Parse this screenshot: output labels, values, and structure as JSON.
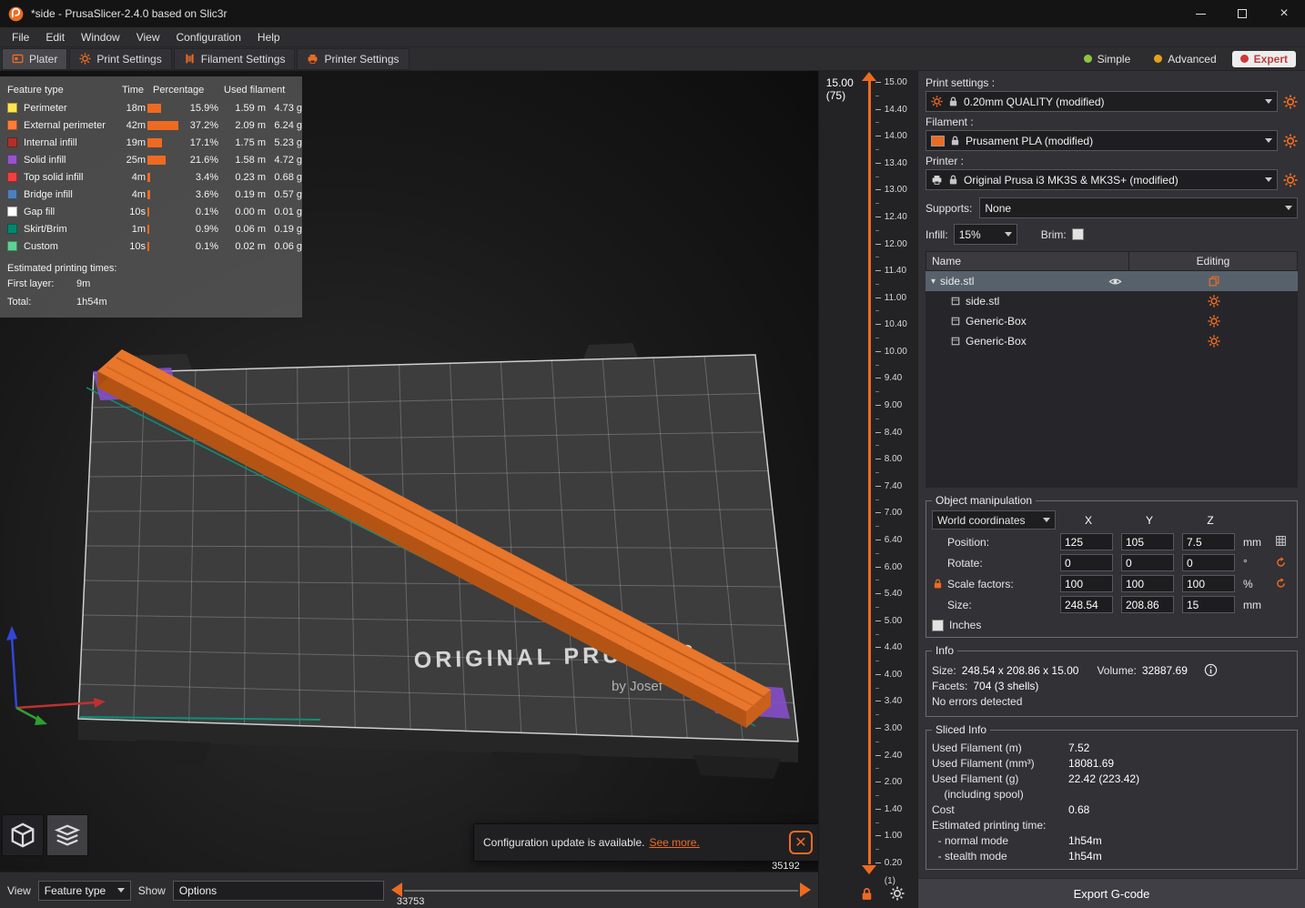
{
  "window": {
    "title": "*side - PrusaSlicer-2.4.0 based on Slic3r"
  },
  "menubar": [
    "File",
    "Edit",
    "Window",
    "View",
    "Configuration",
    "Help"
  ],
  "tabbar": {
    "tabs": [
      {
        "label": "Plater",
        "icon": "plater-icon",
        "active": true
      },
      {
        "label": "Print Settings",
        "icon": "gear-icon"
      },
      {
        "label": "Filament Settings",
        "icon": "filament-icon"
      },
      {
        "label": "Printer Settings",
        "icon": "printer-icon"
      }
    ],
    "modes": [
      {
        "label": "Simple",
        "dot": "#8cc63f"
      },
      {
        "label": "Advanced",
        "dot": "#e8a017"
      },
      {
        "label": "Expert",
        "dot": "#d03838",
        "active": true
      }
    ]
  },
  "legend": {
    "headers": {
      "feature": "Feature type",
      "time": "Time",
      "pct": "Percentage",
      "used": "Used filament"
    },
    "rows": [
      {
        "name": "Perimeter",
        "color": "#ffe64d",
        "time": "18m",
        "pct": "15.9%",
        "pct_val": 15.9,
        "len": "1.59 m",
        "wt": "4.73 g"
      },
      {
        "name": "External perimeter",
        "color": "#ff7d38",
        "time": "42m",
        "pct": "37.2%",
        "pct_val": 37.2,
        "len": "2.09 m",
        "wt": "6.24 g"
      },
      {
        "name": "Internal infill",
        "color": "#b03029",
        "time": "19m",
        "pct": "17.1%",
        "pct_val": 17.1,
        "len": "1.75 m",
        "wt": "5.23 g"
      },
      {
        "name": "Solid infill",
        "color": "#9654cc",
        "time": "25m",
        "pct": "21.6%",
        "pct_val": 21.6,
        "len": "1.58 m",
        "wt": "4.72 g"
      },
      {
        "name": "Top solid infill",
        "color": "#f04040",
        "time": "4m",
        "pct": "3.4%",
        "pct_val": 3.4,
        "len": "0.23 m",
        "wt": "0.68 g"
      },
      {
        "name": "Bridge infill",
        "color": "#4d80ba",
        "time": "4m",
        "pct": "3.6%",
        "pct_val": 3.6,
        "len": "0.19 m",
        "wt": "0.57 g"
      },
      {
        "name": "Gap fill",
        "color": "#ffffff",
        "time": "10s",
        "pct": "0.1%",
        "pct_val": 0.1,
        "len": "0.00 m",
        "wt": "0.01 g"
      },
      {
        "name": "Skirt/Brim",
        "color": "#008770",
        "time": "1m",
        "pct": "0.9%",
        "pct_val": 0.9,
        "len": "0.06 m",
        "wt": "0.19 g"
      },
      {
        "name": "Custom",
        "color": "#5ed194",
        "time": "10s",
        "pct": "0.1%",
        "pct_val": 0.1,
        "len": "0.02 m",
        "wt": "0.06 g"
      }
    ],
    "times_title": "Estimated printing times:",
    "first_layer_label": "First layer:",
    "first_layer_value": "9m",
    "total_label": "Total:",
    "total_value": "1h54m"
  },
  "viewport": {
    "bed_text": "ORIGINAL PRUSA i3",
    "bed_subtext": "by Josef",
    "notification": {
      "message": "Configuration update is available.",
      "link": "See more."
    }
  },
  "bottombar": {
    "view_label": "View",
    "view_value": "Feature type",
    "show_label": "Show",
    "show_value": "Options",
    "slider_max_label": "35192",
    "slider_min_label": "33753"
  },
  "layer_slider": {
    "top_value": "15.00",
    "top_index": "(75)",
    "bottom_value": "0.20",
    "bottom_index": "(1)",
    "ticks": [
      "15.00",
      "14.40",
      "14.00",
      "13.40",
      "13.00",
      "12.40",
      "12.00",
      "11.40",
      "11.00",
      "10.40",
      "10.00",
      "9.40",
      "9.00",
      "8.40",
      "8.00",
      "7.40",
      "7.00",
      "6.40",
      "6.00",
      "5.40",
      "5.00",
      "4.40",
      "4.00",
      "3.40",
      "3.00",
      "2.40",
      "2.00",
      "1.40",
      "1.00",
      "0.20"
    ]
  },
  "sidebar": {
    "print_settings_label": "Print settings :",
    "print_settings_value": "0.20mm QUALITY (modified)",
    "filament_label": "Filament :",
    "filament_value": "Prusament PLA (modified)",
    "printer_label": "Printer :",
    "printer_value": "Original Prusa i3 MK3S & MK3S+ (modified)",
    "supports_label": "Supports:",
    "supports_value": "None",
    "infill_label": "Infill:",
    "infill_value": "15%",
    "brim_label": "Brim:",
    "object_list": {
      "name_header": "Name",
      "editing_header": "Editing",
      "rows": [
        {
          "label": "side.stl",
          "type": "object",
          "selected": true,
          "expanded": true
        },
        {
          "label": "side.stl",
          "type": "part"
        },
        {
          "label": "Generic-Box",
          "type": "modifier"
        },
        {
          "label": "Generic-Box",
          "type": "modifier"
        }
      ]
    },
    "manipulation": {
      "title": "Object manipulation",
      "coords_value": "World coordinates",
      "axis_headers": [
        "X",
        "Y",
        "Z"
      ],
      "rows": [
        {
          "label": "Position:",
          "values": [
            "125",
            "105",
            "7.5"
          ],
          "unit": "mm",
          "trail": "grid-icon"
        },
        {
          "label": "Rotate:",
          "values": [
            "0",
            "0",
            "0"
          ],
          "unit": "°",
          "trail": "reset-icon"
        },
        {
          "label": "Scale factors:",
          "values": [
            "100",
            "100",
            "100"
          ],
          "unit": "%",
          "trail": "reset-icon",
          "lock": true
        },
        {
          "label": "Size:",
          "values": [
            "248.54",
            "208.86",
            "15"
          ],
          "unit": "mm",
          "trail": ""
        }
      ],
      "inches_label": "Inches"
    },
    "info": {
      "title": "Info",
      "size_label": "Size:",
      "size_value": "248.54 x 208.86 x 15.00",
      "volume_label": "Volume:",
      "volume_value": "32887.69",
      "facets_label": "Facets:",
      "facets_value": "704 (3 shells)",
      "errors": "No errors detected"
    },
    "sliced": {
      "title": "Sliced Info",
      "rows": [
        {
          "label": "Used Filament (m)",
          "value": "7.52"
        },
        {
          "label": "Used Filament (mm³)",
          "value": "18081.69"
        },
        {
          "label": "Used Filament (g)",
          "value": "22.42 (223.42)"
        },
        {
          "label": "    (including spool)",
          "value": ""
        },
        {
          "label": "Cost",
          "value": "0.68"
        },
        {
          "label": "Estimated printing time:",
          "value": ""
        },
        {
          "label": "  - normal mode",
          "value": "1h54m"
        },
        {
          "label": "  - stealth mode",
          "value": "1h54m"
        }
      ]
    },
    "export_button": "Export G-code"
  },
  "colors": {
    "accent": "#ED6B21",
    "bed": "#3d3d3d",
    "model": "#e8762b",
    "modifier": "#8a4fd0",
    "selected_row": "#57616c"
  }
}
